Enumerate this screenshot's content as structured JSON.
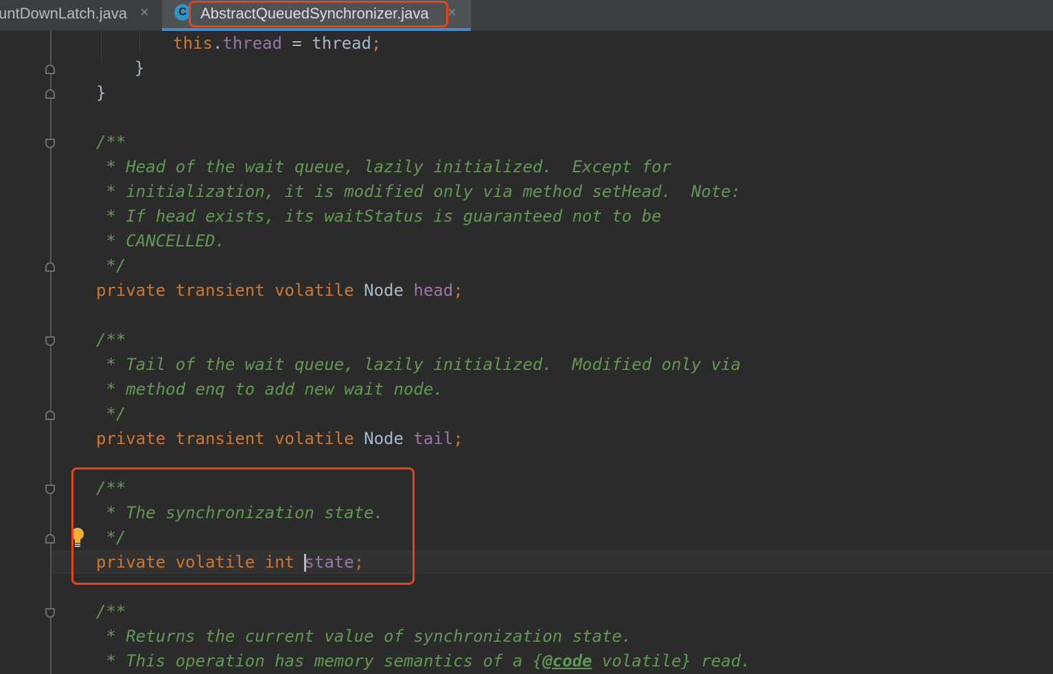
{
  "tabs": [
    {
      "label": "untDownLatch.java",
      "close": "×",
      "active": false
    },
    {
      "label": "AbstractQueuedSynchronizer.java",
      "close": "×",
      "active": true,
      "icon": "C"
    }
  ],
  "colors": {
    "keyword": "#cc7832",
    "field": "#9876aa",
    "comment": "#629755",
    "text": "#a9b7c6",
    "background": "#2b2b2b",
    "highlight_box": "#e8441a"
  },
  "icons": {
    "file_icon": "java-class-icon",
    "intention": "lightbulb-icon"
  },
  "code": {
    "l1": {
      "kw": "this",
      "dot": ".",
      "field": "thread",
      "rest": " = thread",
      "semi": ";"
    },
    "l2": "}",
    "l3": "}",
    "doc1": [
      "/**",
      " * Head of the wait queue, lazily initialized.  Except for",
      " * initialization, it is modified only via method setHead.  Note:",
      " * If head exists, its waitStatus is guaranteed not to be",
      " * CANCELLED.",
      " */"
    ],
    "decl1": {
      "mods": "private transient volatile ",
      "type": "Node ",
      "field": "head",
      "semi": ";"
    },
    "doc2": [
      "/**",
      " * Tail of the wait queue, lazily initialized.  Modified only via",
      " * method enq to add new wait node.",
      " */"
    ],
    "decl2": {
      "mods": "private transient volatile ",
      "type": "Node ",
      "field": "tail",
      "semi": ";"
    },
    "doc3": [
      "/**",
      " * The synchronization state.",
      " */"
    ],
    "decl3": {
      "mods": "private volatile int ",
      "field": "state",
      "semi": ";"
    },
    "doc4": {
      "open": "/**",
      "line1": " * Returns the current value of synchronization state.",
      "line2_pre": " * This operation has memory semantics of a {",
      "line2_tag": "@code",
      "line2_post": " volatile} read."
    }
  }
}
